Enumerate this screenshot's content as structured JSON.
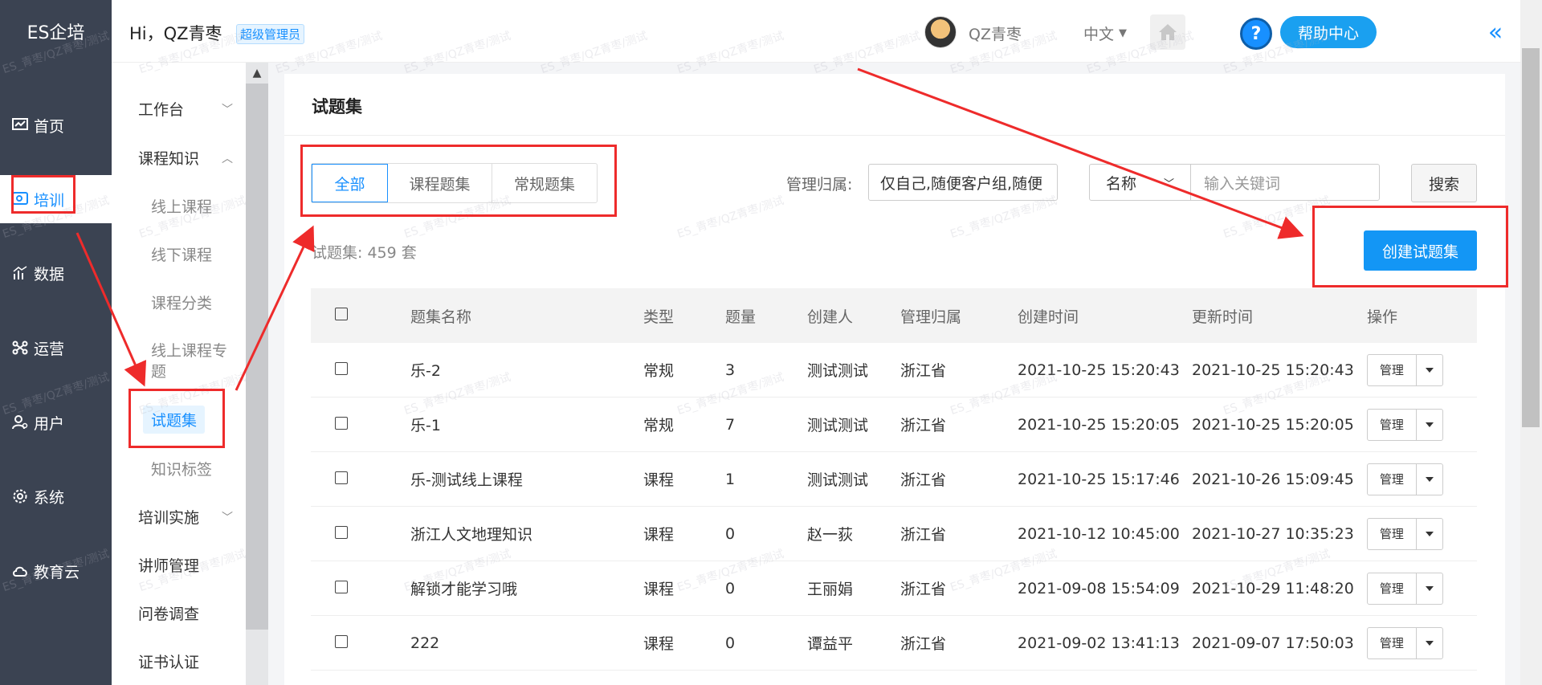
{
  "brand": "ES企培",
  "nav": [
    {
      "label": "首页",
      "icon": "dashboard-icon"
    },
    {
      "label": "培训",
      "icon": "training-icon"
    },
    {
      "label": "数据",
      "icon": "chart-icon"
    },
    {
      "label": "运营",
      "icon": "operation-icon"
    },
    {
      "label": "用户",
      "icon": "user-icon"
    },
    {
      "label": "系统",
      "icon": "gear-icon"
    },
    {
      "label": "教育云",
      "icon": "cloud-icon"
    }
  ],
  "header": {
    "greeting": "Hi，QZ青枣",
    "role": "超级管理员",
    "username": "QZ青枣",
    "language": "中文",
    "help": "帮助中心"
  },
  "submenu": {
    "workbench": "工作台",
    "course_knowledge": "课程知识",
    "children": [
      "线上课程",
      "线下课程",
      "课程分类",
      "线上课程专题",
      "试题集",
      "知识标签"
    ],
    "training_impl": "培训实施",
    "lecturer": "讲师管理",
    "survey": "问卷调查",
    "certificate": "证书认证"
  },
  "main": {
    "title": "试题集",
    "tabs": [
      "全部",
      "课程题集",
      "常规题集"
    ],
    "filter_label": "管理归属:",
    "filter_value": "仅自己,随便客户组,随便",
    "select_value": "名称",
    "keyword_placeholder": "输入关键词",
    "search_label": "搜索",
    "count_text": "试题集:  459 套",
    "create_label": "创建试题集"
  },
  "table": {
    "headers": [
      "题集名称",
      "类型",
      "题量",
      "创建人",
      "管理归属",
      "创建时间",
      "更新时间",
      "操作"
    ],
    "op_label": "管理",
    "rows": [
      [
        "乐-2",
        "常规",
        "3",
        "测试测试",
        "浙江省",
        "2021-10-25 15:20:43",
        "2021-10-25 15:20:43"
      ],
      [
        "乐-1",
        "常规",
        "7",
        "测试测试",
        "浙江省",
        "2021-10-25 15:20:05",
        "2021-10-25 15:20:05"
      ],
      [
        "乐-测试线上课程",
        "课程",
        "1",
        "测试测试",
        "浙江省",
        "2021-10-25 15:17:46",
        "2021-10-26 15:09:45"
      ],
      [
        "浙江人文地理知识",
        "课程",
        "0",
        "赵一荻",
        "浙江省",
        "2021-10-12 10:45:00",
        "2021-10-27 10:35:23"
      ],
      [
        "解锁才能学习哦",
        "课程",
        "0",
        "王丽娟",
        "浙江省",
        "2021-09-08 15:54:09",
        "2021-10-29 11:48:20"
      ],
      [
        "222",
        "课程",
        "0",
        "谭益平",
        "浙江省",
        "2021-09-02 13:41:13",
        "2021-09-07 17:50:03"
      ]
    ]
  },
  "watermark": "ES_青枣/QZ青枣/测试",
  "colors": {
    "accent": "#1890ff",
    "sidebar": "#3b4352",
    "annotation": "#ee2b2b"
  }
}
